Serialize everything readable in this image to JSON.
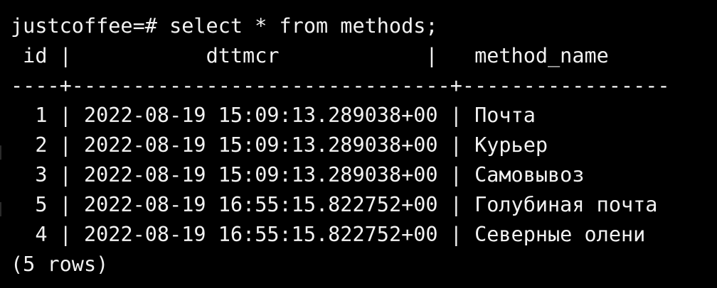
{
  "terminal": {
    "prompt": "justcoffee=#",
    "command": "select * from methods;",
    "columns": [
      "id",
      "dttmcr",
      "method_name"
    ],
    "rows": [
      {
        "id": "1",
        "dttmcr": "2022-08-19 15:09:13.289038+00",
        "method_name": "Почта"
      },
      {
        "id": "2",
        "dttmcr": "2022-08-19 15:09:13.289038+00",
        "method_name": "Курьер"
      },
      {
        "id": "3",
        "dttmcr": "2022-08-19 15:09:13.289038+00",
        "method_name": "Самовывоз"
      },
      {
        "id": "5",
        "dttmcr": "2022-08-19 16:55:15.822752+00",
        "method_name": "Голубиная почта"
      },
      {
        "id": "4",
        "dttmcr": "2022-08-19 16:55:15.822752+00",
        "method_name": "Северные олени"
      }
    ],
    "footer": "(5 rows)"
  },
  "colors": {
    "background": "#000000",
    "text": "#f2f2f2"
  }
}
